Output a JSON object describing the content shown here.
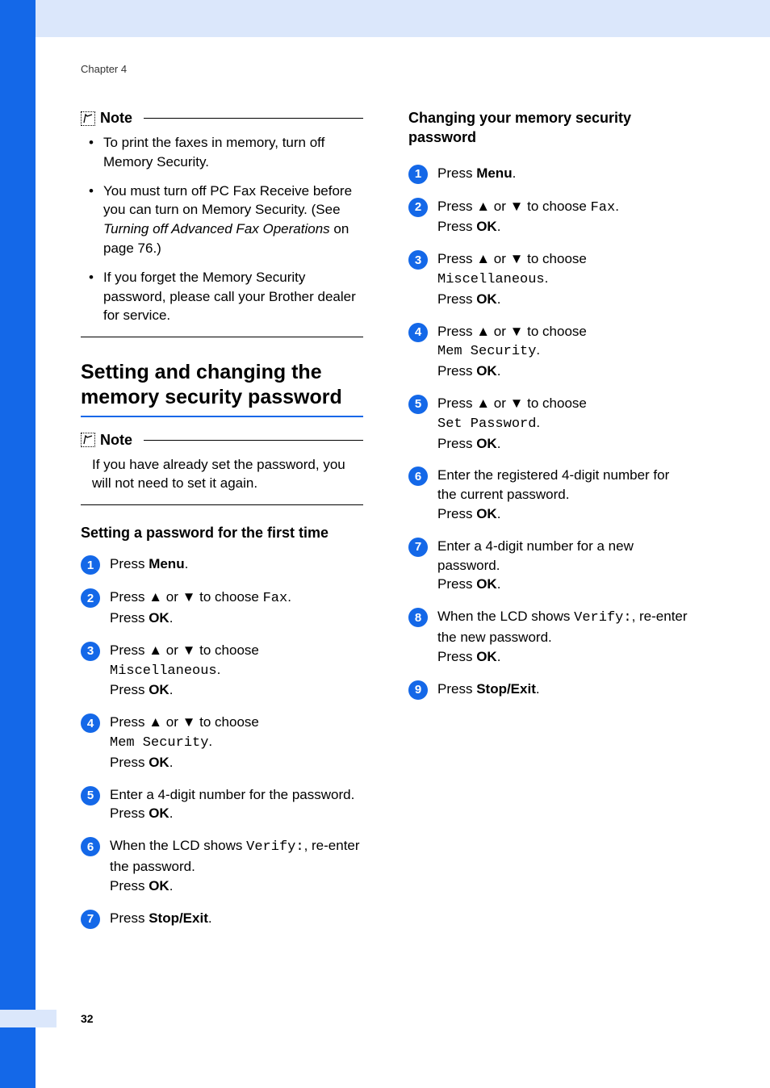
{
  "chapter": "Chapter 4",
  "page_number": "32",
  "note1": {
    "title": "Note",
    "items": [
      {
        "text": "To print the faxes in memory, turn off Memory Security."
      },
      {
        "pre": "You must turn off PC Fax Receive before you can turn on Memory Security. (See ",
        "link": "Turning off Advanced Fax Operations",
        "post": " on page 76.)"
      },
      {
        "text": "If you forget the Memory Security password, please call your Brother dealer for service."
      }
    ]
  },
  "h2_left": "Setting and changing the memory security password",
  "note2": {
    "title": "Note",
    "body": "If you have already set the password, you will not need to set it again."
  },
  "h3_left": "Setting a password for the first time",
  "steps_left": [
    {
      "n": "1",
      "parts": [
        {
          "t": "Press "
        },
        {
          "b": "Menu"
        },
        {
          "t": "."
        }
      ]
    },
    {
      "n": "2",
      "parts": [
        {
          "t": "Press "
        },
        {
          "sym": "▲"
        },
        {
          "t": " or "
        },
        {
          "sym": "▼"
        },
        {
          "t": " to choose "
        },
        {
          "m": "Fax"
        },
        {
          "t": "."
        },
        {
          "br": true
        },
        {
          "t": "Press "
        },
        {
          "b": "OK"
        },
        {
          "t": "."
        }
      ]
    },
    {
      "n": "3",
      "parts": [
        {
          "t": "Press "
        },
        {
          "sym": "▲"
        },
        {
          "t": " or "
        },
        {
          "sym": "▼"
        },
        {
          "t": " to choose "
        },
        {
          "br": true
        },
        {
          "m": "Miscellaneous"
        },
        {
          "t": "."
        },
        {
          "br": true
        },
        {
          "t": "Press "
        },
        {
          "b": "OK"
        },
        {
          "t": "."
        }
      ]
    },
    {
      "n": "4",
      "parts": [
        {
          "t": "Press "
        },
        {
          "sym": "▲"
        },
        {
          "t": " or "
        },
        {
          "sym": "▼"
        },
        {
          "t": " to choose "
        },
        {
          "br": true
        },
        {
          "m": "Mem Security"
        },
        {
          "t": "."
        },
        {
          "br": true
        },
        {
          "t": "Press "
        },
        {
          "b": "OK"
        },
        {
          "t": "."
        }
      ]
    },
    {
      "n": "5",
      "parts": [
        {
          "t": "Enter a 4-digit number for the password."
        },
        {
          "br": true
        },
        {
          "t": "Press "
        },
        {
          "b": "OK"
        },
        {
          "t": "."
        }
      ]
    },
    {
      "n": "6",
      "parts": [
        {
          "t": "When the LCD shows "
        },
        {
          "m": "Verify:"
        },
        {
          "t": ", re-enter the password."
        },
        {
          "br": true
        },
        {
          "t": "Press "
        },
        {
          "b": "OK"
        },
        {
          "t": "."
        }
      ]
    },
    {
      "n": "7",
      "parts": [
        {
          "t": "Press "
        },
        {
          "b": "Stop/Exit"
        },
        {
          "t": "."
        }
      ]
    }
  ],
  "h3_right": "Changing your memory security password",
  "steps_right": [
    {
      "n": "1",
      "parts": [
        {
          "t": "Press "
        },
        {
          "b": "Menu"
        },
        {
          "t": "."
        }
      ]
    },
    {
      "n": "2",
      "parts": [
        {
          "t": "Press "
        },
        {
          "sym": "▲"
        },
        {
          "t": " or "
        },
        {
          "sym": "▼"
        },
        {
          "t": " to choose "
        },
        {
          "m": "Fax"
        },
        {
          "t": "."
        },
        {
          "br": true
        },
        {
          "t": "Press "
        },
        {
          "b": "OK"
        },
        {
          "t": "."
        }
      ]
    },
    {
      "n": "3",
      "parts": [
        {
          "t": "Press "
        },
        {
          "sym": "▲"
        },
        {
          "t": " or "
        },
        {
          "sym": "▼"
        },
        {
          "t": " to choose "
        },
        {
          "br": true
        },
        {
          "m": "Miscellaneous"
        },
        {
          "t": "."
        },
        {
          "br": true
        },
        {
          "t": "Press "
        },
        {
          "b": "OK"
        },
        {
          "t": "."
        }
      ]
    },
    {
      "n": "4",
      "parts": [
        {
          "t": "Press "
        },
        {
          "sym": "▲"
        },
        {
          "t": " or "
        },
        {
          "sym": "▼"
        },
        {
          "t": " to choose "
        },
        {
          "br": true
        },
        {
          "m": "Mem Security"
        },
        {
          "t": "."
        },
        {
          "br": true
        },
        {
          "t": "Press "
        },
        {
          "b": "OK"
        },
        {
          "t": "."
        }
      ]
    },
    {
      "n": "5",
      "parts": [
        {
          "t": "Press "
        },
        {
          "sym": "▲"
        },
        {
          "t": " or "
        },
        {
          "sym": "▼"
        },
        {
          "t": " to choose "
        },
        {
          "br": true
        },
        {
          "m": "Set Password"
        },
        {
          "t": "."
        },
        {
          "br": true
        },
        {
          "t": "Press "
        },
        {
          "b": "OK"
        },
        {
          "t": "."
        }
      ]
    },
    {
      "n": "6",
      "parts": [
        {
          "t": "Enter the registered 4-digit number for the current password."
        },
        {
          "br": true
        },
        {
          "t": "Press "
        },
        {
          "b": "OK"
        },
        {
          "t": "."
        }
      ]
    },
    {
      "n": "7",
      "parts": [
        {
          "t": "Enter a 4-digit number for a new password."
        },
        {
          "br": true
        },
        {
          "t": "Press "
        },
        {
          "b": "OK"
        },
        {
          "t": "."
        }
      ]
    },
    {
      "n": "8",
      "parts": [
        {
          "t": "When the LCD shows "
        },
        {
          "m": "Verify:"
        },
        {
          "t": ", re-enter the new password."
        },
        {
          "br": true
        },
        {
          "t": "Press "
        },
        {
          "b": "OK"
        },
        {
          "t": "."
        }
      ]
    },
    {
      "n": "9",
      "parts": [
        {
          "t": "Press "
        },
        {
          "b": "Stop/Exit"
        },
        {
          "t": "."
        }
      ]
    }
  ]
}
